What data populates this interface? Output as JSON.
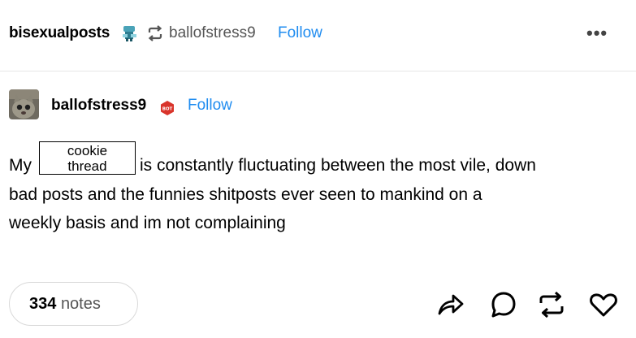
{
  "header": {
    "blog_name": "bisexualposts",
    "reblogged_from": "ballofstress9",
    "follow_label": "Follow",
    "more_label": "•••",
    "icons": [
      "blog-badge-icon",
      "reblog-icon",
      "more-options-icon"
    ]
  },
  "post": {
    "author": "ballofstress9",
    "follow_label": "Follow",
    "badge_text": "BOT",
    "text_prefix": "My",
    "box_line1": "cookie",
    "box_line2": "thread",
    "line1_rest": "is constantly fluctuating between the most vile, down",
    "line2": "bad posts and the funnies shitposts ever seen to mankind on a",
    "line3": "weekly basis and im not complaining"
  },
  "footer": {
    "notes_count": "334",
    "notes_label": "notes",
    "actions": [
      "share-icon",
      "reply-icon",
      "reblog-icon",
      "like-icon"
    ]
  },
  "colors": {
    "accent": "#1f8cf0",
    "bot_badge": "#d9342b",
    "text": "#000000",
    "muted": "#555555"
  }
}
